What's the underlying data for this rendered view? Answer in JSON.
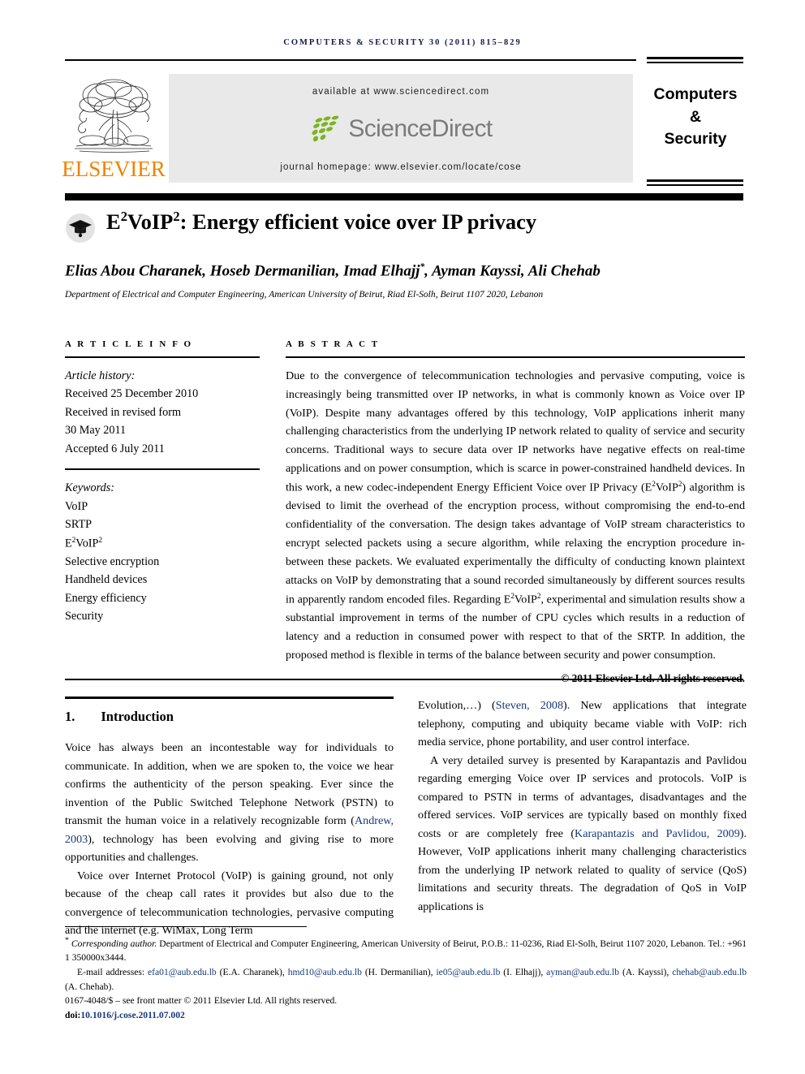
{
  "header": {
    "journal_ref": "COMPUTERS & SECURITY 30 (2011) 815–829",
    "available_at": "available at www.sciencedirect.com",
    "sciencedirect_wordmark": "ScienceDirect",
    "journal_homepage": "journal homepage: www.elsevier.com/locate/cose",
    "publisher_wordmark": "ELSEVIER",
    "journal_box": "Computers\n&\nSecurity",
    "journal_box_line1": "Computers",
    "journal_box_line2": "&",
    "journal_box_line3": "Security"
  },
  "article": {
    "title_main": "VoIP",
    "title_full": "E2VoIP2: Energy efficient voice over IP privacy",
    "title_prefix": "E",
    "title_sup1": "2",
    "title_mid": "VoIP",
    "title_sup2": "2",
    "title_rest": ": Energy efficient voice over IP privacy",
    "authors": "Elias Abou Charanek, Hoseb Dermanilian, Imad Elhajj*, Ayman Kayssi, Ali Chehab",
    "authors_pre": "Elias Abou Charanek, Hoseb Dermanilian, Imad Elhajj",
    "authors_star": "*",
    "authors_post": ", Ayman Kayssi, Ali Chehab",
    "affiliation": "Department of Electrical and Computer Engineering, American University of Beirut, Riad El-Solh, Beirut 1107 2020, Lebanon"
  },
  "article_info": {
    "heading": "A R T I C L E  I N F O",
    "history_label": "Article history:",
    "history": [
      "Received 25 December 2010",
      "Received in revised form",
      "30 May 2011",
      "Accepted 6 July 2011"
    ],
    "keywords_label": "Keywords:",
    "keywords": [
      "VoIP",
      "SRTP",
      "E²VoIP²",
      "Selective encryption",
      "Handheld devices",
      "Energy efficiency",
      "Security"
    ],
    "keyword_e2voip_prefix": "E",
    "keyword_e2voip_sup1": "2",
    "keyword_e2voip_mid": "VoIP",
    "keyword_e2voip_sup2": "2"
  },
  "abstract": {
    "heading": "A B S T R A C T",
    "paragraph_part1": "Due to the convergence of telecommunication technologies and pervasive computing, voice is increasingly being transmitted over IP networks, in what is commonly known as Voice over IP (VoIP). Despite many advantages offered by this technology, VoIP applications inherit many challenging characteristics from the underlying IP network related to quality of service and security concerns. Traditional ways to secure data over IP networks have negative effects on real-time applications and on power consumption, which is scarce in power-constrained handheld devices. In this work, a new codec-independent Energy Efficient Voice over IP Privacy (E",
    "paragraph_part2": ") algorithm is devised to limit the overhead of the encryption process, without compromising the end-to-end confidentiality of the conversation. The design takes advantage of VoIP stream characteristics to encrypt selected packets using a secure algorithm, while relaxing the encryption procedure in-between these packets. We evaluated experimentally the difficulty of conducting known plaintext attacks on VoIP by demonstrating that a sound recorded simultaneously by different sources results in apparently random encoded files. Regarding E",
    "paragraph_part3": ", experimental and simulation results show a substantial improvement in terms of the number of CPU cycles which results in a reduction of latency and a reduction in consumed power with respect to that of the SRTP. In addition, the proposed method is flexible in terms of the balance between security and power consumption.",
    "copyright": "© 2011 Elsevier Ltd. All rights reserved."
  },
  "introduction": {
    "number": "1.",
    "title": "Introduction",
    "left_p1_a": "Voice has always been an incontestable way for individuals to communicate. In addition, when we are spoken to, the voice we hear confirms the authenticity of the person speaking. Ever since the invention of the Public Switched Telephone Network (PSTN) to transmit the human voice in a relatively recognizable form (",
    "left_p1_cite": "Andrew, 2003",
    "left_p1_b": "), technology has been evolving and giving rise to more opportunities and challenges.",
    "left_p2": "Voice over Internet Protocol (VoIP) is gaining ground, not only because of the cheap call rates it provides but also due to the convergence of telecommunication technologies, pervasive computing and the internet (e.g. WiMax, Long Term",
    "right_p1_a": "Evolution,…) (",
    "right_p1_cite": "Steven, 2008",
    "right_p1_b": "). New applications that integrate telephony, computing and ubiquity became viable with VoIP: rich media service, phone portability, and user control interface.",
    "right_p2_a": "A very detailed survey is presented by Karapantazis and Pavlidou regarding emerging Voice over IP services and protocols. VoIP is compared to PSTN in terms of advantages, disadvantages and the offered services. VoIP services are typically based on monthly fixed costs or are completely free (",
    "right_p2_cite": "Karapantazis and Pavlidou, 2009",
    "right_p2_b": "). However, VoIP applications inherit many challenging characteristics from the underlying IP network related to quality of service (QoS) limitations and security threats. The degradation of QoS in VoIP applications is"
  },
  "footnote": {
    "corresponding_label": "Corresponding author.",
    "corresponding_rest": " Department of Electrical and Computer Engineering, American University of Beirut, P.O.B.: 11-0236, Riad El-Solh, Beirut 1107 2020, Lebanon. Tel.: +961 1 350000x3444.",
    "email_label": "E-mail addresses:",
    "emails": [
      {
        "address": "efa01@aub.edu.lb",
        "person": "(E.A. Charanek)"
      },
      {
        "address": "hmd10@aub.edu.lb",
        "person": "(H. Dermanilian)"
      },
      {
        "address": "ie05@aub.edu.lb",
        "person": "(I. Elhajj)"
      },
      {
        "address": "ayman@aub.edu.lb",
        "person": "(A. Kayssi)"
      },
      {
        "address": "chehab@aub.edu.lb",
        "person": "(A. Chehab)"
      }
    ],
    "issn_line": "0167-4048/$ – see front matter © 2011 Elsevier Ltd. All rights reserved.",
    "doi_label": "doi:",
    "doi_value": "10.1016/j.cose.2011.07.002"
  },
  "colors": {
    "link": "#15387a",
    "elsevier_orange": "#ef8200",
    "journal_ref_navy": "#141a4e",
    "sciencedirect_gray": "#7b7b7b",
    "banner_bg": "#e9e9e9"
  }
}
